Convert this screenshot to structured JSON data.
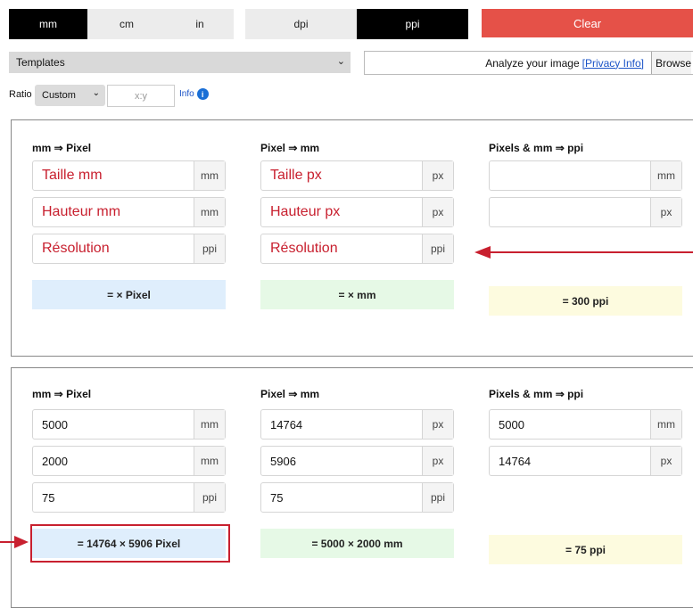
{
  "units": {
    "length": [
      {
        "label": "mm",
        "active": true
      },
      {
        "label": "cm",
        "active": false
      },
      {
        "label": "in",
        "active": false
      }
    ],
    "density": [
      {
        "label": "dpi",
        "active": false
      },
      {
        "label": "ppi",
        "active": true
      }
    ],
    "clear_label": "Clear"
  },
  "templates": {
    "selected": "Templates"
  },
  "analyze": {
    "text": "Analyze your image",
    "privacy_link": "[Privacy Info]",
    "browse": "Browse"
  },
  "ratio": {
    "label": "Ratio",
    "selected": "Custom",
    "placeholder": "x:y",
    "info_label": "Info",
    "info_icon": "i"
  },
  "panel1": {
    "mm_to_px": {
      "title": "mm ⇒ Pixel",
      "fields": [
        {
          "value": "Taille mm",
          "unit": "mm"
        },
        {
          "value": "Hauteur mm",
          "unit": "mm"
        },
        {
          "value": "Résolution",
          "unit": "ppi"
        }
      ],
      "result": "= × Pixel"
    },
    "px_to_mm": {
      "title": "Pixel ⇒ mm",
      "fields": [
        {
          "value": "Taille px",
          "unit": "px"
        },
        {
          "value": "Hauteur px",
          "unit": "px"
        },
        {
          "value": "Résolution",
          "unit": "ppi"
        }
      ],
      "result": "= × mm"
    },
    "to_ppi": {
      "title": "Pixels & mm ⇒ ppi",
      "fields": [
        {
          "value": "",
          "unit": "mm"
        },
        {
          "value": "",
          "unit": "px"
        }
      ],
      "result": "= 300 ppi"
    }
  },
  "panel2": {
    "mm_to_px": {
      "title": "mm ⇒ Pixel",
      "fields": [
        {
          "value": "5000",
          "unit": "mm"
        },
        {
          "value": "2000",
          "unit": "mm"
        },
        {
          "value": "75",
          "unit": "ppi"
        }
      ],
      "result": "= 14764 × 5906 Pixel"
    },
    "px_to_mm": {
      "title": "Pixel ⇒ mm",
      "fields": [
        {
          "value": "14764",
          "unit": "px"
        },
        {
          "value": "5906",
          "unit": "px"
        },
        {
          "value": "75",
          "unit": "ppi"
        }
      ],
      "result": "= 5000 × 2000 mm"
    },
    "to_ppi": {
      "title": "Pixels & mm ⇒ ppi",
      "fields": [
        {
          "value": "5000",
          "unit": "mm"
        },
        {
          "value": "14764",
          "unit": "px"
        }
      ],
      "result": "= 75 ppi"
    }
  },
  "colors": {
    "clear_button": "#e55148",
    "annotation_red": "#c8202f",
    "link_blue": "#1a53c7"
  }
}
